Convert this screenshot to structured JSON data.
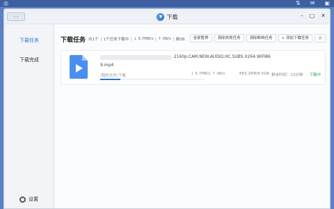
{
  "desktop": {
    "icons": [
      "app-icon",
      "sort-icon",
      "mail-icon",
      "chat-icon"
    ]
  },
  "window": {
    "title": "下载",
    "controls": [
      "–",
      "▢",
      "✕"
    ]
  },
  "sidebar": {
    "items": [
      {
        "label": "下载任务",
        "active": true
      },
      {
        "label": "下载完成",
        "active": false
      }
    ],
    "settings_label": "设置"
  },
  "header": {
    "title": "下载任务",
    "stats": [
      "共1个",
      "1个任务下载中",
      "↓ 5.7MB/s",
      "↑ 0B/s",
      "剩0B"
    ],
    "buttons": [
      "全部暂停",
      "清除失败任务",
      "清除断档任务",
      "+ 添加下载任务"
    ]
  },
  "task": {
    "filename_line1": ".2160p.CAM.NEW.AUDIO.HC.SUBS.X264.WiFi86",
    "filename_line2": "9.mp4",
    "path": "/我的文件/下载",
    "progress": 0.19,
    "down_speed": "↓ 5.7MB/s",
    "up_speed": "↑ 0B/s",
    "size": "883.2MB/8.5GB",
    "remaining": "剩余时间：23分钟",
    "state": "下载中",
    "colors": {
      "accent": "#2d6fd6",
      "state": "#3aa55a",
      "file_icon": "#4a8ef0"
    }
  }
}
